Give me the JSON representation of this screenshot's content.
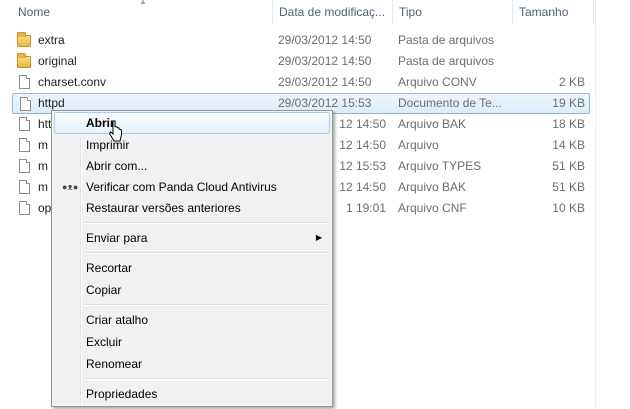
{
  "columns": {
    "name": "Nome",
    "date": "Data de modificaç...",
    "type": "Tipo",
    "size": "Tamanho"
  },
  "files": [
    {
      "name": "extra",
      "date": "29/03/2012 14:50",
      "type": "Pasta de arquivos",
      "size": "",
      "icon": "folder-icon"
    },
    {
      "name": "original",
      "date": "29/03/2012 14:50",
      "type": "Pasta de arquivos",
      "size": "",
      "icon": "folder-icon"
    },
    {
      "name": "charset.conv",
      "date": "29/03/2012 14:50",
      "type": "Arquivo CONV",
      "size": "2 KB",
      "icon": "file-icon"
    },
    {
      "name": "httpd",
      "date": "29/03/2012 15:53",
      "type": "Documento de Te...",
      "size": "19 KB",
      "icon": "file-icon",
      "selected": true
    },
    {
      "name": "htt",
      "date": "12 14:50",
      "type": "Arquivo BAK",
      "size": "18 KB",
      "icon": "file-icon"
    },
    {
      "name": "m",
      "date": "12 14:50",
      "type": "Arquivo",
      "size": "14 KB",
      "icon": "file-icon"
    },
    {
      "name": "m",
      "date": "12 15:53",
      "type": "Arquivo TYPES",
      "size": "51 KB",
      "icon": "file-icon"
    },
    {
      "name": "m",
      "date": "12 14:50",
      "type": "Arquivo BAK",
      "size": "51 KB",
      "icon": "file-icon"
    },
    {
      "name": "op",
      "date": "1 19:01",
      "type": "Arquivo CNF",
      "size": "10 KB",
      "icon": "file-icon"
    }
  ],
  "context_menu": {
    "open": "Abrir",
    "print": "Imprimir",
    "open_with": "Abrir com...",
    "antivirus": "Verificar com Panda Cloud Antivirus",
    "restore": "Restaurar versões anteriores",
    "send_to": "Enviar para",
    "cut": "Recortar",
    "copy": "Copiar",
    "create_shortcut": "Criar atalho",
    "delete": "Excluir",
    "rename": "Renomear",
    "properties": "Propriedades",
    "hovered": "open"
  }
}
